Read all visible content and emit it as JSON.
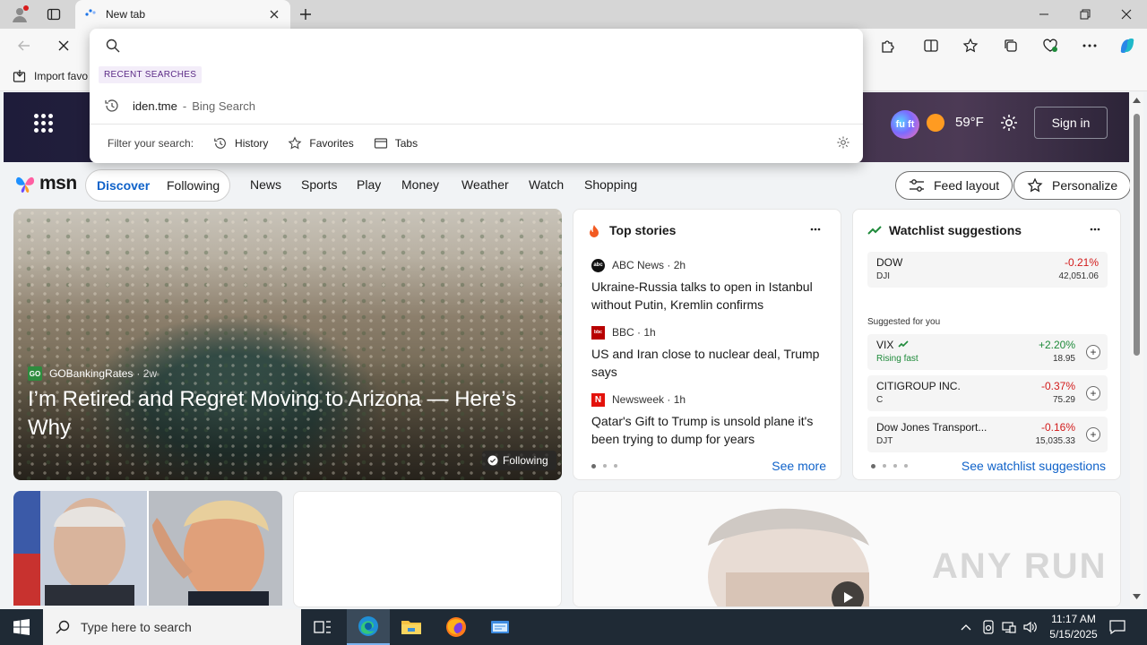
{
  "browser": {
    "tab_title": "New tab",
    "favorites_import": "Import favo"
  },
  "omnibox": {
    "input_value": "",
    "recent_label": "RECENT SEARCHES",
    "recent_query": "iden.tme",
    "recent_separator": "-",
    "recent_engine": "Bing Search",
    "filter_label": "Filter your search:",
    "filters": [
      "History",
      "Favorites",
      "Tabs"
    ]
  },
  "banner": {
    "copilot_text": "fu ft",
    "temperature": "59°F",
    "signin_label": "Sign in"
  },
  "nav": {
    "logo": "msn",
    "discover": "Discover",
    "following": "Following",
    "items": [
      "News",
      "Sports",
      "Play",
      "Money",
      "Weather",
      "Watch",
      "Shopping"
    ],
    "feed_layout": "Feed layout",
    "personalize": "Personalize"
  },
  "hero": {
    "source": "GOBankingRates",
    "source_logo": "GO",
    "age": "· 2w",
    "title": "I’m Retired and Regret Moving to Arizona — Here’s Why",
    "following_label": "Following"
  },
  "top_stories": {
    "title": "Top stories",
    "stories": [
      {
        "source": "ABC News",
        "age": "· 2h",
        "title": "Ukraine-Russia talks to open in Istanbul without Putin, Kremlin confirms",
        "logo": "abc"
      },
      {
        "source": "BBC",
        "age": "· 1h",
        "title": "US and Iran close to nuclear deal, Trump says",
        "logo": "bbc"
      },
      {
        "source": "Newsweek",
        "age": "· 1h",
        "title": "Qatar's Gift to Trump is unsold plane it's been trying to dump for years",
        "logo": "N"
      }
    ],
    "see_more": "See more"
  },
  "watchlist": {
    "title": "Watchlist suggestions",
    "main": {
      "name": "DOW",
      "symbol": "DJI",
      "change": "-0.21%",
      "price": "42,051.06"
    },
    "suggested_label": "Suggested for you",
    "suggestions": [
      {
        "name": "VIX",
        "symbol": "",
        "note": "Rising fast",
        "change": "+2.20%",
        "price": "18.95"
      },
      {
        "name": "CITIGROUP INC.",
        "symbol": "C",
        "change": "-0.37%",
        "price": "75.29"
      },
      {
        "name": "Dow Jones Transport...",
        "symbol": "DJT",
        "change": "-0.16%",
        "price": "15,035.33"
      }
    ],
    "add_symbol": "+",
    "see_all": "See watchlist suggestions"
  },
  "watermark": "ANY RUN",
  "taskbar": {
    "search_placeholder": "Type here to search",
    "time": "11:17 AM",
    "date": "5/15/2025"
  },
  "colors": {
    "accent": "#0f62c9",
    "negative": "#d21b1b",
    "positive": "#1e8a3a"
  }
}
